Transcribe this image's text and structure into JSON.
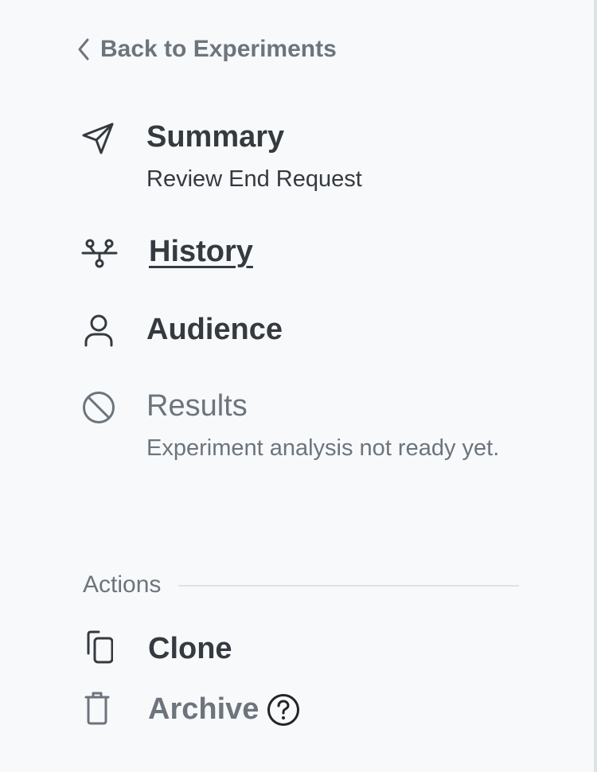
{
  "back_link": {
    "label": "Back to Experiments",
    "icon": "chevron-left-icon"
  },
  "nav": {
    "summary": {
      "title": "Summary",
      "subtitle": "Review End Request",
      "icon": "send-icon"
    },
    "history": {
      "title": "History",
      "icon": "network-icon",
      "active": true
    },
    "audience": {
      "title": "Audience",
      "icon": "user-icon"
    },
    "results": {
      "title": "Results",
      "subtitle": "Experiment analysis not ready yet.",
      "icon": "block-icon",
      "disabled": true
    }
  },
  "actions": {
    "header": "Actions",
    "clone": {
      "label": "Clone",
      "icon": "copy-icon"
    },
    "archive": {
      "label": "Archive",
      "icon": "trash-icon",
      "help_icon": "question-circle-icon"
    }
  },
  "colors": {
    "background": "#f8f9fa",
    "text": "#343a40",
    "muted": "#6c757d",
    "divider": "#dee2e6"
  }
}
